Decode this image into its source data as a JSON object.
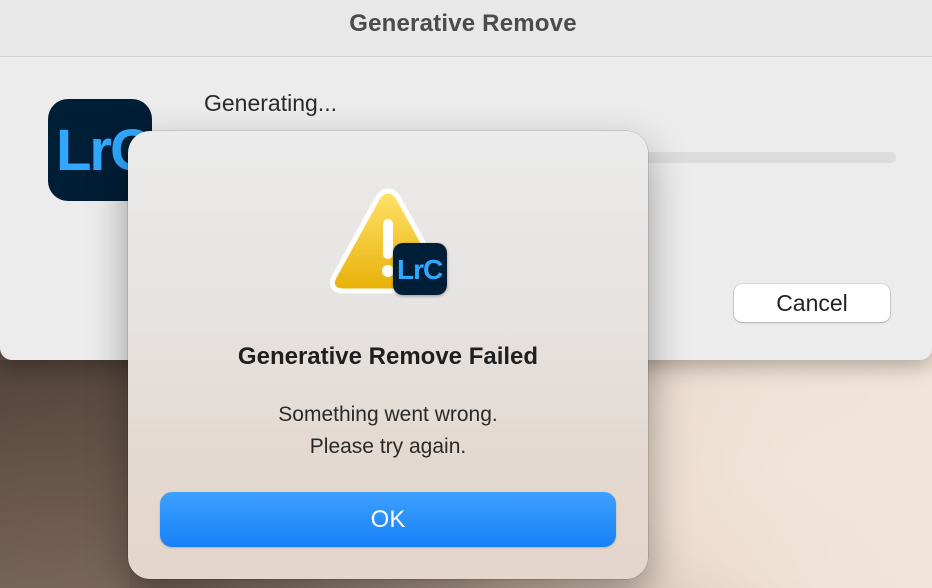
{
  "main_window": {
    "title": "Generative Remove",
    "app_icon_text": "LrC",
    "status_text": "Generating...",
    "progress": 0,
    "cancel_label": "Cancel"
  },
  "alert": {
    "icon": "warning-triangle-icon",
    "badge_icon_text": "LrC",
    "title": "Generative Remove Failed",
    "message_lines": [
      "Something went wrong.",
      "Please try again."
    ],
    "ok_label": "OK"
  },
  "colors": {
    "accent": "#1680f7",
    "warning": "#f2c417",
    "lightroom_bg": "#001e36",
    "lightroom_text": "#31a8ff"
  }
}
